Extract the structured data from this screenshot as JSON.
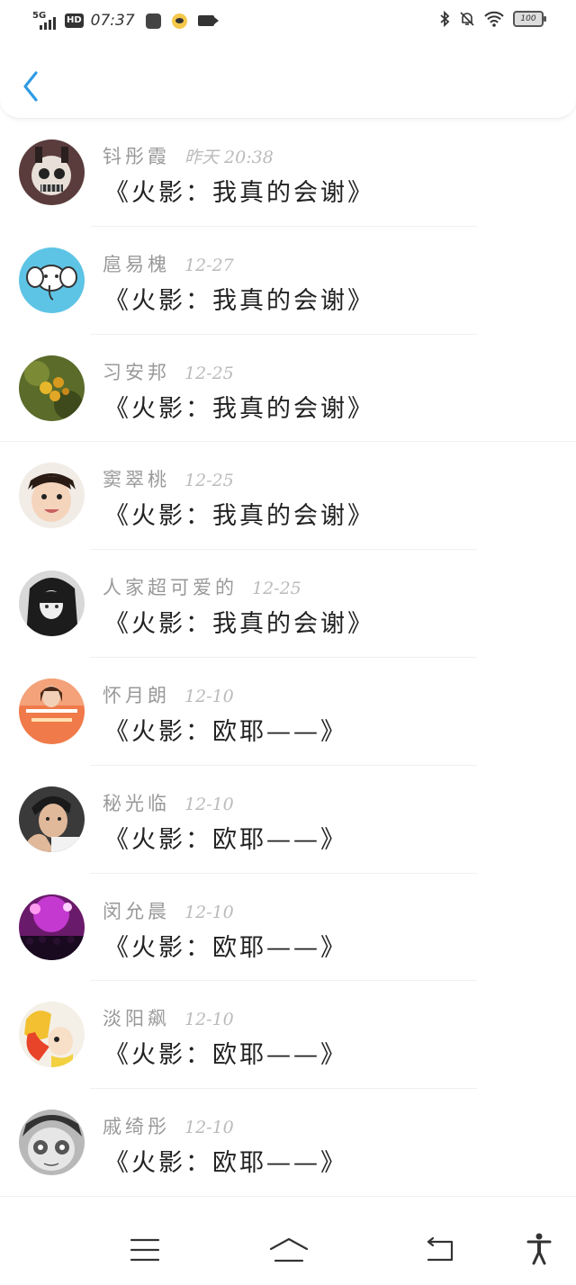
{
  "status_bar": {
    "network": "5G",
    "hd": "HD",
    "time": "07:37",
    "battery": "100"
  },
  "header": {
    "back_icon": "chevron-left-icon",
    "accent": "#2f9be4"
  },
  "messages": [
    {
      "name": "钭彤霞",
      "time": "昨天 20:38",
      "text": "《火影：我真的会谢》"
    },
    {
      "name": "扈易槐",
      "time": "12-27",
      "text": "《火影：我真的会谢》"
    },
    {
      "name": "习安邦",
      "time": "12-25",
      "text": "《火影：我真的会谢》"
    },
    {
      "name": "窦翠桃",
      "time": "12-25",
      "text": "《火影：我真的会谢》"
    },
    {
      "name": "人家超可爱的",
      "time": "12-25",
      "text": "《火影：我真的会谢》"
    },
    {
      "name": "怀月朗",
      "time": "12-10",
      "text": "《火影：欧耶——》"
    },
    {
      "name": "秘光临",
      "time": "12-10",
      "text": "《火影：欧耶——》"
    },
    {
      "name": "闵允晨",
      "time": "12-10",
      "text": "《火影：欧耶——》"
    },
    {
      "name": "淡阳飙",
      "time": "12-10",
      "text": "《火影：欧耶——》"
    },
    {
      "name": "戚绮彤",
      "time": "12-10",
      "text": "《火影：欧耶——》"
    }
  ],
  "bottom_nav": {
    "icons": [
      "menu-icon",
      "home-icon",
      "back-icon",
      "accessibility-icon"
    ]
  }
}
